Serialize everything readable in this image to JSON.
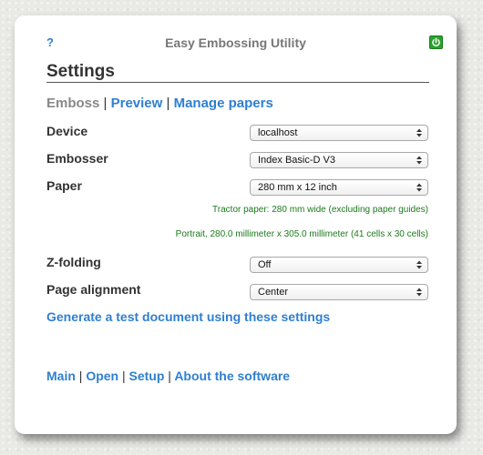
{
  "header": {
    "help_label": "?",
    "title": "Easy Embossing Utility",
    "power_icon": "power-icon",
    "power_color": "#2aa32d"
  },
  "page": {
    "heading": "Settings"
  },
  "nav": {
    "current": "Emboss",
    "separator": "|",
    "links": [
      "Preview",
      "Manage papers"
    ]
  },
  "form": {
    "device": {
      "label": "Device",
      "value": "localhost"
    },
    "embosser": {
      "label": "Embosser",
      "value": "Index Basic-D V3"
    },
    "paper": {
      "label": "Paper",
      "value": "280 mm x 12 inch"
    },
    "paper_note_1": "Tractor paper: 280 mm wide (excluding paper guides)",
    "paper_note_2": "Portrait, 280.0 millimeter x 305.0 millimeter (41 cells x 30 cells)",
    "zfolding": {
      "label": "Z-folding",
      "value": "Off"
    },
    "alignment": {
      "label": "Page alignment",
      "value": "Center"
    }
  },
  "actions": {
    "generate_test": "Generate a test document using these settings"
  },
  "footer": {
    "links": [
      "Main",
      "Open",
      "Setup",
      "About the software"
    ],
    "separator": "|"
  },
  "colors": {
    "link": "#2f7fd0",
    "note": "#1c7a1c",
    "heading": "#333333",
    "title": "#777777"
  }
}
